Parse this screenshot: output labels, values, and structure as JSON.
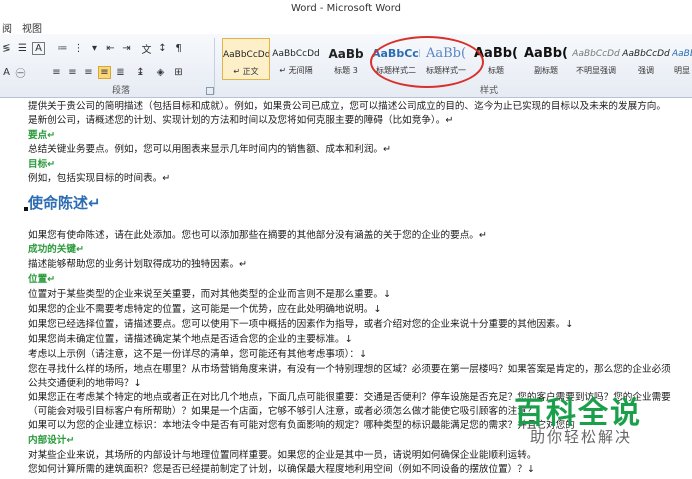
{
  "window": {
    "title": "Word - Microsoft Word"
  },
  "menu": {
    "item_partial": "阅",
    "view": "视图"
  },
  "ribbon": {
    "paragraph_group_label": "段落",
    "styles_group_label": "样式",
    "styles": [
      {
        "preview": "AaBbCcDd",
        "name": "↵ 正文",
        "selected": true
      },
      {
        "preview": "AaBbCcDd",
        "name": "↵ 无间隔",
        "selected": false
      },
      {
        "preview": "AaBb",
        "name": "标题 3",
        "selected": false
      },
      {
        "preview": "AaBbCcl",
        "name": "标题样式二",
        "selected": false
      },
      {
        "preview": "AaBb(",
        "name": "标题样式一",
        "selected": false
      },
      {
        "preview": "AaBb(",
        "name": "标题",
        "selected": false
      },
      {
        "preview": "AaBb(",
        "name": "副标题",
        "selected": false
      },
      {
        "preview": "AaBbCcDd",
        "name": "不明显强调",
        "selected": false
      },
      {
        "preview": "AaBbCcDd",
        "name": "强调",
        "selected": false
      },
      {
        "preview": "AaBb",
        "name": "明显",
        "selected": false
      }
    ]
  },
  "document": {
    "lines": [
      "提供关于贵公司的简明描述（包括目标和成就）。例如，如果贵公司已成立，您可以描述公司成立的目的、迄今为止已实现的目标以及未来的发展方向。",
      "是新创公司，请概述您的计划、实现计划的方法和时间以及您将如何克服主要的障碍（比如竞争）。↵",
      "要点↵",
      "总结关键业务要点。例如，您可以用图表来显示几年时间内的销售额、成本和利润。↵",
      "目标↵",
      "例如，包括实现目标的时间表。↵",
      "使命陈述↵",
      "如果您有使命陈述，请在此处添加。您也可以添加那些在摘要的其他部分没有涵盖的关于您的企业的要点。↵",
      "成功的关键↵",
      "描述能够帮助您的业务计划取得成功的独特因素。↵",
      "位置↵",
      "位置对于某些类型的企业来说至关重要，而对其他类型的企业而言则不是那么重要。↓",
      "如果您的企业不需要考虑特定的位置，这可能是一个优势，应在此处明确地说明。↓",
      "如果您已经选择位置，请描述要点。您可以使用下一项中概括的因素作为指导，或者介绍对您的企业来说十分重要的其他因素。↓",
      "如果您尚未确定位置，请描述确定某个地点是否适合您的企业的主要标准。↓",
      "考虑以上示例（请注意，这不是一份详尽的清单，您可能还有其他考虑事项）：↓",
      "您在寻找什么样的场所，地点在哪里？从市场营销角度来讲，有没有一个特别理想的区域？必须要在第一层楼吗？如果答案是肯定的，那么您的企业必须",
      "公共交通便利的地带吗？↓",
      "如果您正在考虑某个特定的地点或者正在对比几个地点，下面几点可能很重要：交通是否便利？停车设施是否充足？您的客户需要到访吗？您的企业需要",
      "（可能会对吸引目标客户有所帮助）？如果是一个店面，它够不够引人注意，或者必须怎么做才能使它吸引顾客的注意？",
      "如果可以为您的企业建立标识：本地法令中是否有可能对您有负面影响的规定？哪种类型的标识最能满足您的需求？并且它对您的",
      "内部设计↵",
      "对某些企业来说，其场所的内部设计与地理位置同样重要。如果您的企业是其中一员，请说明如何确保企业能顺利运转。",
      "您如何计算所需的建筑面积？您是否已经提前制定了计划，以确保最大程度地利用空间（例如不同设备的摆放位置）？↓"
    ]
  },
  "watermark": {
    "big": "百科全说",
    "small": "助你轻松解决"
  }
}
